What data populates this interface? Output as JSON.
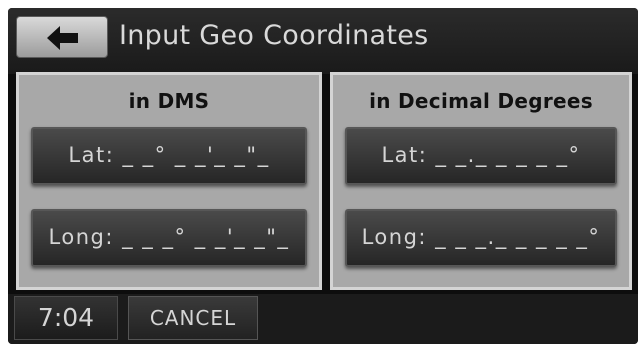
{
  "header": {
    "title": "Input Geo Coordinates",
    "back_icon": "left-arrow-icon"
  },
  "dms_panel": {
    "heading": "in DMS",
    "lat_label": "Lat: _ _° _ _'_ _\"_",
    "long_label": "Long: _ _ _° _ _'_ _\"_"
  },
  "decimal_panel": {
    "heading": "in Decimal Degrees",
    "lat_label": "Lat: _ _._ _ _ _ _°",
    "long_label": "Long: _ _ _._ _ _ _ _°"
  },
  "footer": {
    "time": "7:04",
    "cancel_label": "CANCEL"
  },
  "colors": {
    "screen_bg": "#0d0d0d",
    "panel_bg": "#a8a8a8",
    "button_bg": "#2e2e2e",
    "text": "#d5d5d5"
  }
}
